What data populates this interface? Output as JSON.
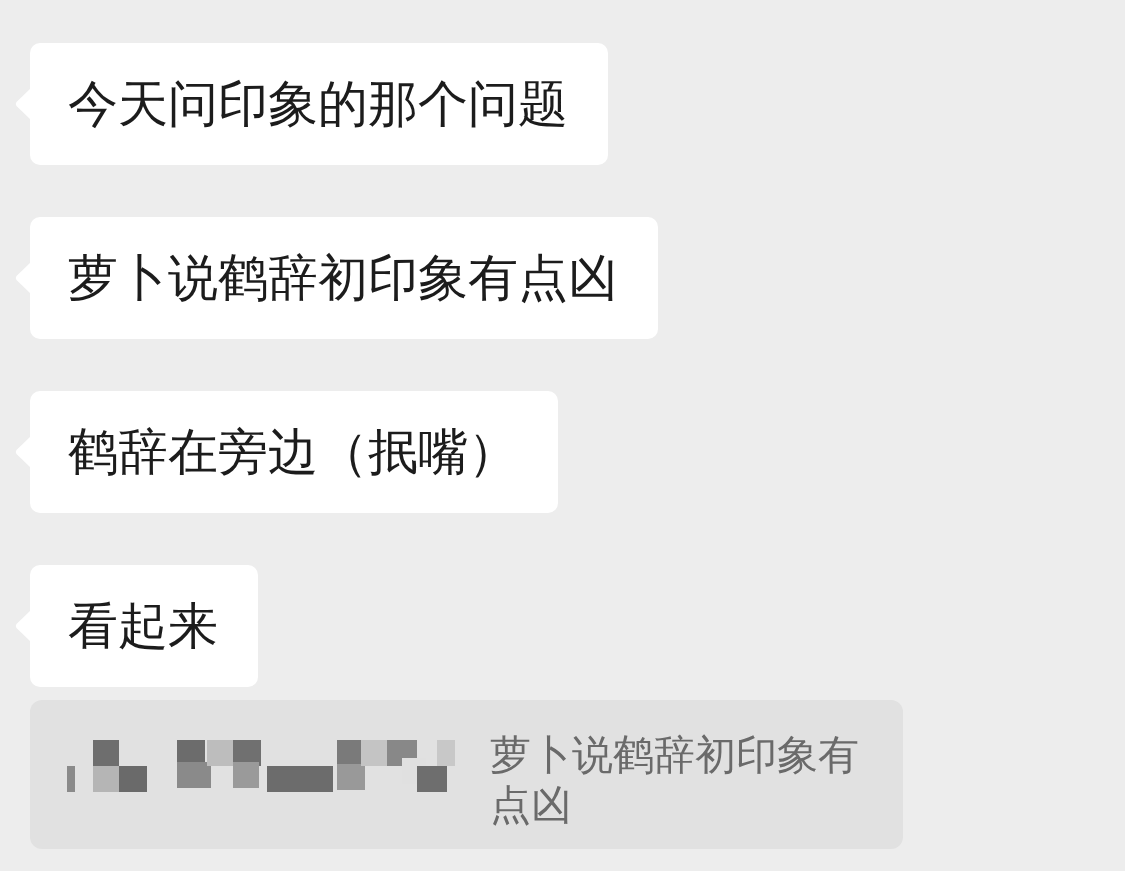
{
  "messages": [
    {
      "text": "今天问印象的那个问题"
    },
    {
      "text": "萝卜说鹤辞初印象有点凶"
    },
    {
      "text": "鹤辞在旁边（抿嘴）"
    },
    {
      "text": "看起来"
    }
  ],
  "quote": {
    "text": "萝卜说鹤辞初印象有点凶"
  }
}
